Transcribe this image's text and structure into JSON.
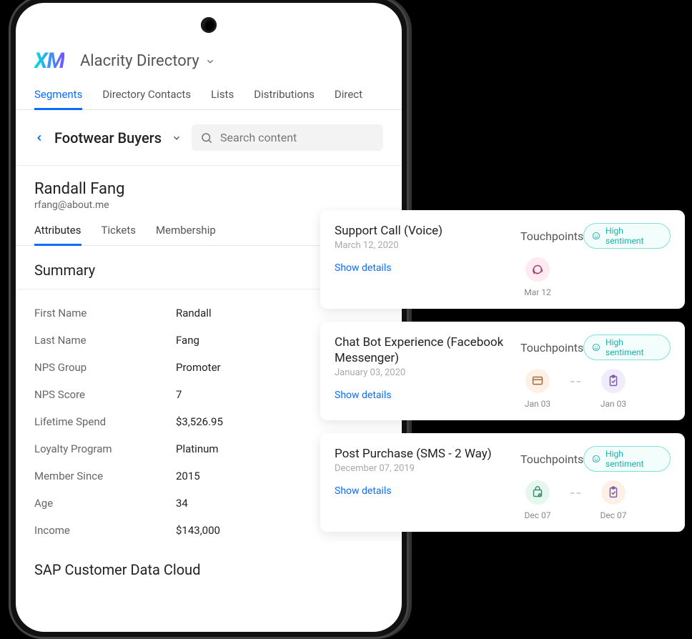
{
  "header": {
    "logo_text": "XM",
    "directory_label": "Alacrity Directory"
  },
  "top_tabs": [
    "Segments",
    "Directory Contacts",
    "Lists",
    "Distributions",
    "Direct"
  ],
  "active_top_tab": 0,
  "segment": {
    "title": "Footwear Buyers",
    "search_placeholder": "Search content"
  },
  "contact": {
    "name": "Randall Fang",
    "email": "rfang@about.me"
  },
  "sub_tabs": [
    "Attributes",
    "Tickets",
    "Membership"
  ],
  "active_sub_tab": 0,
  "summary_title": "Summary",
  "attributes": [
    {
      "label": "First Name",
      "value": "Randall"
    },
    {
      "label": "Last Name",
      "value": "Fang"
    },
    {
      "label": "NPS Group",
      "value": "Promoter"
    },
    {
      "label": "NPS Score",
      "value": "7"
    },
    {
      "label": "Lifetime Spend",
      "value": "$3,526.95"
    },
    {
      "label": "Loyalty Program",
      "value": "Platinum"
    },
    {
      "label": "Member Since",
      "value": "2015"
    },
    {
      "label": "Age",
      "value": "34"
    },
    {
      "label": "Income",
      "value": "$143,000"
    }
  ],
  "cdc_title": "SAP Customer Data Cloud",
  "touchpoint_header": "Touchpoints",
  "sentiment_label": "High sentiment",
  "show_details_label": "Show details",
  "cards": [
    {
      "title": "Support Call (Voice)",
      "date": "March 12, 2020",
      "steps": [
        {
          "label": "Mar 12",
          "icon": "headset",
          "tone": "pink"
        }
      ]
    },
    {
      "title": "Chat Bot Experience (Facebook Messenger)",
      "date": "January 03, 2020",
      "steps": [
        {
          "label": "Jan 03",
          "icon": "window",
          "tone": "peach"
        },
        {
          "label": "Jan 03",
          "icon": "clipboard",
          "tone": "lav"
        }
      ]
    },
    {
      "title": "Post Purchase (SMS - 2 Way)",
      "date": "December 07, 2019",
      "steps": [
        {
          "label": "Dec 07",
          "icon": "cart",
          "tone": "mint"
        },
        {
          "label": "Dec 07",
          "icon": "clipboard",
          "tone": "peach"
        }
      ]
    }
  ]
}
